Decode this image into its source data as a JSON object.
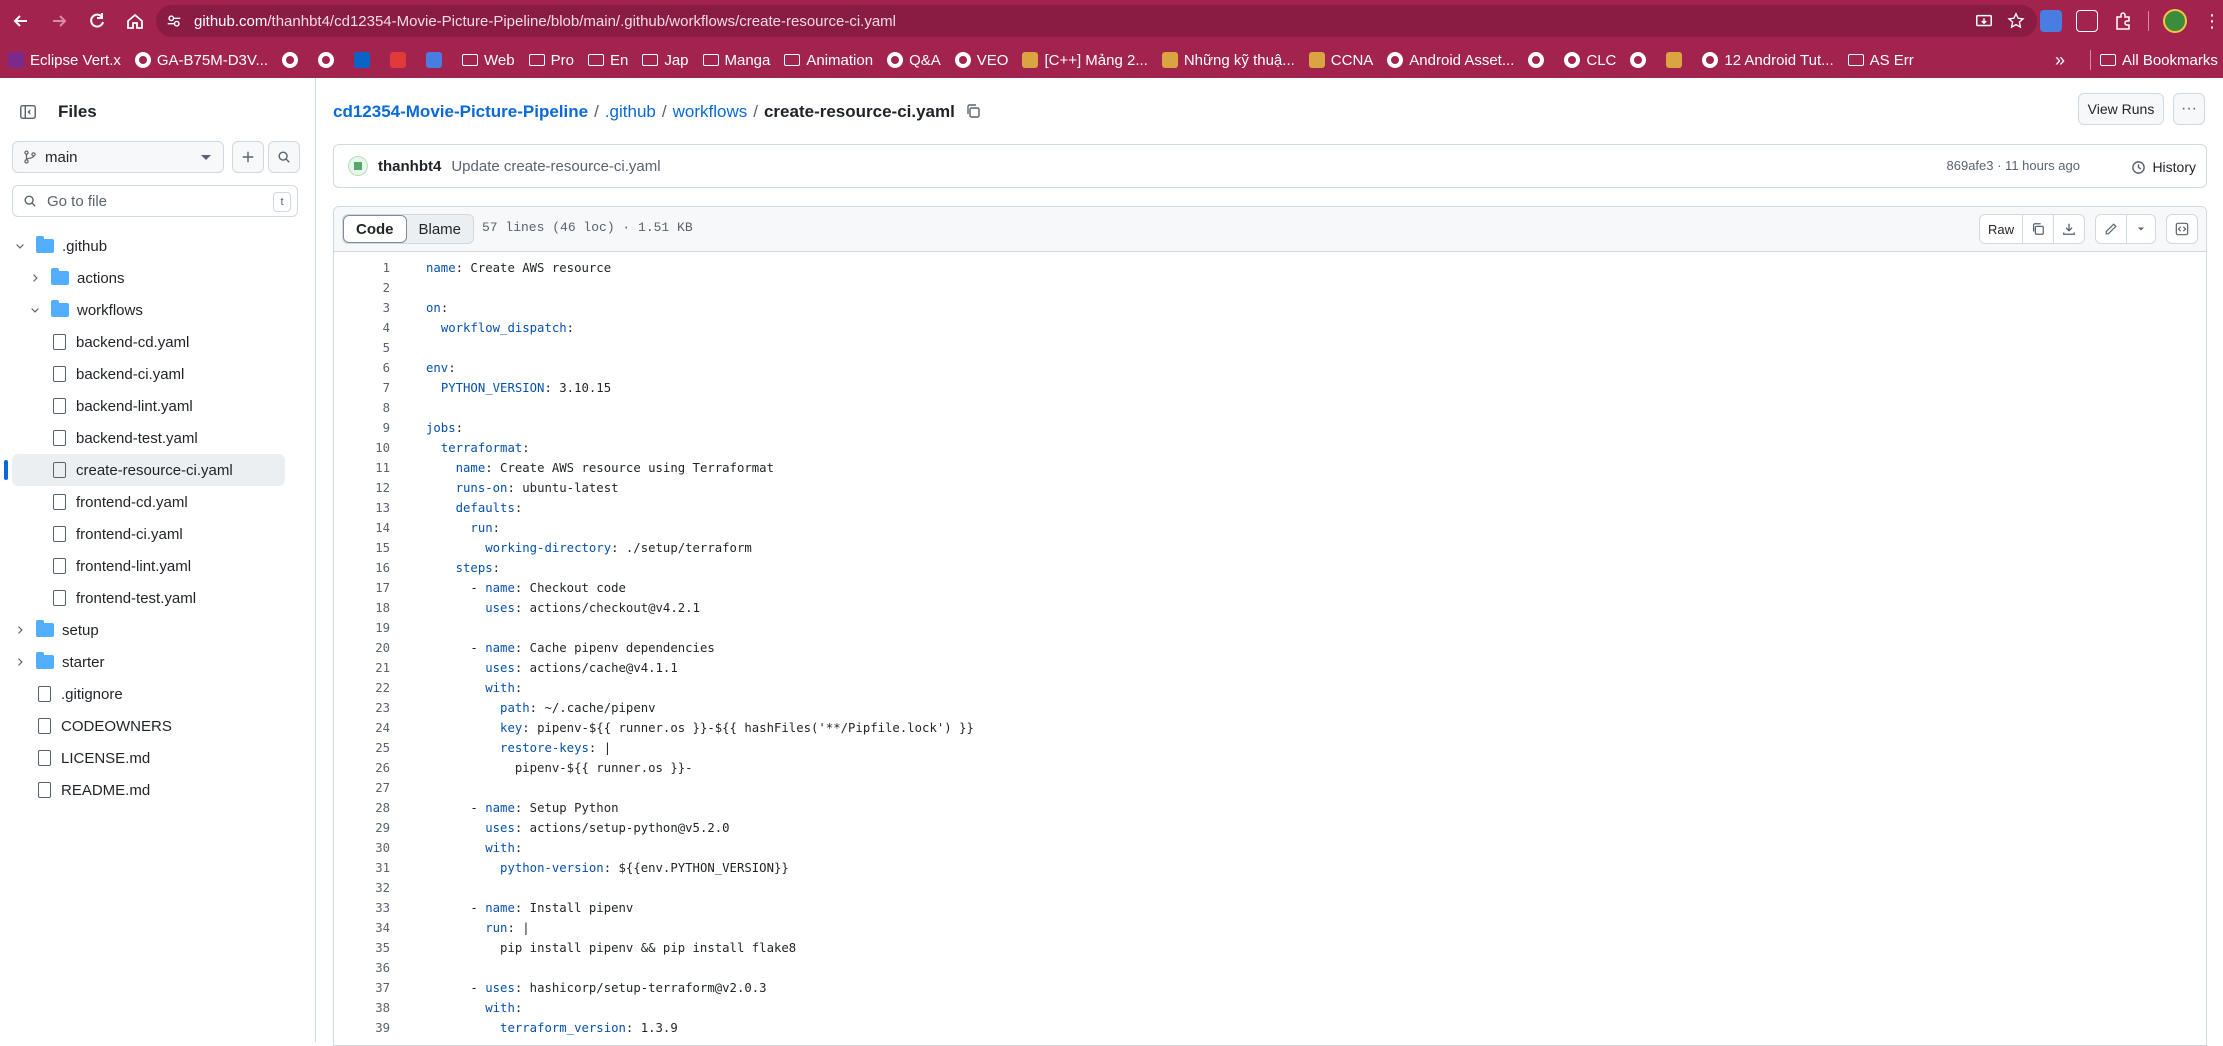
{
  "browser": {
    "url_domain": "github.com",
    "url_path": "/thanhbt4/cd12354-Movie-Picture-Pipeline/blob/main/.github/workflows/create-resource-ci.yaml",
    "bookmarks": [
      {
        "label": "Eclipse Vert.x",
        "icon": "vertx-icon"
      },
      {
        "label": "GA-B75M-D3V...",
        "icon": "globe-icon"
      },
      {
        "label": "",
        "icon": "globe-icon"
      },
      {
        "label": "",
        "icon": "globe-icon"
      },
      {
        "label": "",
        "icon": "outlook-icon"
      },
      {
        "label": "",
        "icon": "red-app-icon"
      },
      {
        "label": "",
        "icon": "translate-icon"
      },
      {
        "label": "Web",
        "icon": "folder-icon"
      },
      {
        "label": "Pro",
        "icon": "folder-icon"
      },
      {
        "label": "En",
        "icon": "folder-icon"
      },
      {
        "label": "Jap",
        "icon": "folder-icon"
      },
      {
        "label": "Manga",
        "icon": "folder-icon"
      },
      {
        "label": "Animation",
        "icon": "folder-icon"
      },
      {
        "label": "Q&A",
        "icon": "globe-icon"
      },
      {
        "label": "VEO",
        "icon": "globe-icon"
      },
      {
        "label": "[C++] Mảng 2...",
        "icon": "site-icon"
      },
      {
        "label": "Những kỹ thuậ...",
        "icon": "site-icon"
      },
      {
        "label": "CCNA",
        "icon": "site-icon"
      },
      {
        "label": "Android Asset...",
        "icon": "globe-icon"
      },
      {
        "label": "",
        "icon": "globe-icon"
      },
      {
        "label": "CLC",
        "icon": "globe-icon"
      },
      {
        "label": "",
        "icon": "globe-icon"
      },
      {
        "label": "",
        "icon": "site-icon"
      },
      {
        "label": "12 Android Tut...",
        "icon": "globe-icon"
      },
      {
        "label": "AS Err",
        "icon": "folder-icon"
      }
    ],
    "more_label": "»",
    "all_bookmarks": "All Bookmarks"
  },
  "sidebar": {
    "title": "Files",
    "branch": "main",
    "goto_placeholder": "Go to file",
    "goto_shortcut": "t",
    "tree": [
      {
        "label": ".github",
        "type": "folder",
        "depth": 0,
        "expanded": true
      },
      {
        "label": "actions",
        "type": "folder",
        "depth": 1,
        "expanded": false
      },
      {
        "label": "workflows",
        "type": "folder",
        "depth": 1,
        "expanded": true
      },
      {
        "label": "backend-cd.yaml",
        "type": "file",
        "depth": 2
      },
      {
        "label": "backend-ci.yaml",
        "type": "file",
        "depth": 2
      },
      {
        "label": "backend-lint.yaml",
        "type": "file",
        "depth": 2
      },
      {
        "label": "backend-test.yaml",
        "type": "file",
        "depth": 2
      },
      {
        "label": "create-resource-ci.yaml",
        "type": "file",
        "depth": 2,
        "active": true
      },
      {
        "label": "frontend-cd.yaml",
        "type": "file",
        "depth": 2
      },
      {
        "label": "frontend-ci.yaml",
        "type": "file",
        "depth": 2
      },
      {
        "label": "frontend-lint.yaml",
        "type": "file",
        "depth": 2
      },
      {
        "label": "frontend-test.yaml",
        "type": "file",
        "depth": 2
      },
      {
        "label": "setup",
        "type": "folder",
        "depth": 0,
        "expanded": false
      },
      {
        "label": "starter",
        "type": "folder",
        "depth": 0,
        "expanded": false
      },
      {
        "label": ".gitignore",
        "type": "file",
        "depth": 0
      },
      {
        "label": "CODEOWNERS",
        "type": "file",
        "depth": 0
      },
      {
        "label": "LICENSE.md",
        "type": "file",
        "depth": 0
      },
      {
        "label": "README.md",
        "type": "file",
        "depth": 0
      }
    ]
  },
  "breadcrumb": {
    "repo": "cd12354-Movie-Picture-Pipeline",
    "dir1": ".github",
    "dir2": "workflows",
    "file": "create-resource-ci.yaml",
    "sep": "/"
  },
  "actions": {
    "view_runs": "View Runs",
    "more": "···"
  },
  "commit": {
    "author": "thanhbt4",
    "message": "Update create-resource-ci.yaml",
    "meta": "869afe3 · 11 hours ago",
    "history": "History"
  },
  "code_header": {
    "tab_code": "Code",
    "tab_blame": "Blame",
    "stats": "57 lines (46 loc) · 1.51 KB",
    "raw": "Raw"
  },
  "code_lines": [
    {
      "n": "1",
      "indent": "",
      "key": "name",
      "rest": ": Create AWS resource"
    },
    {
      "n": "2",
      "indent": "",
      "key": "",
      "rest": ""
    },
    {
      "n": "3",
      "indent": "",
      "key": "on",
      "rest": ":"
    },
    {
      "n": "4",
      "indent": "  ",
      "key": "workflow_dispatch",
      "rest": ":"
    },
    {
      "n": "5",
      "indent": "",
      "key": "",
      "rest": ""
    },
    {
      "n": "6",
      "indent": "",
      "key": "env",
      "rest": ":"
    },
    {
      "n": "7",
      "indent": "  ",
      "key": "PYTHON_VERSION",
      "rest": ": 3.10.15"
    },
    {
      "n": "8",
      "indent": "",
      "key": "",
      "rest": ""
    },
    {
      "n": "9",
      "indent": "",
      "key": "jobs",
      "rest": ":"
    },
    {
      "n": "10",
      "indent": "  ",
      "key": "terraformat",
      "rest": ":"
    },
    {
      "n": "11",
      "indent": "    ",
      "key": "name",
      "rest": ": Create AWS resource using Terraformat"
    },
    {
      "n": "12",
      "indent": "    ",
      "key": "runs-on",
      "rest": ": ubuntu-latest"
    },
    {
      "n": "13",
      "indent": "    ",
      "key": "defaults",
      "rest": ":"
    },
    {
      "n": "14",
      "indent": "      ",
      "key": "run",
      "rest": ":"
    },
    {
      "n": "15",
      "indent": "        ",
      "key": "working-directory",
      "rest": ": ./setup/terraform"
    },
    {
      "n": "16",
      "indent": "    ",
      "key": "steps",
      "rest": ":"
    },
    {
      "n": "17",
      "indent": "      - ",
      "key": "name",
      "rest": ": Checkout code"
    },
    {
      "n": "18",
      "indent": "        ",
      "key": "uses",
      "rest": ": actions/checkout@v4.2.1"
    },
    {
      "n": "19",
      "indent": "",
      "key": "",
      "rest": ""
    },
    {
      "n": "20",
      "indent": "      - ",
      "key": "name",
      "rest": ": Cache pipenv dependencies"
    },
    {
      "n": "21",
      "indent": "        ",
      "key": "uses",
      "rest": ": actions/cache@v4.1.1"
    },
    {
      "n": "22",
      "indent": "        ",
      "key": "with",
      "rest": ":"
    },
    {
      "n": "23",
      "indent": "          ",
      "key": "path",
      "rest": ": ~/.cache/pipenv"
    },
    {
      "n": "24",
      "indent": "          ",
      "key": "key",
      "rest": ": pipenv-${{ runner.os }}-${{ hashFiles('**/Pipfile.lock') }}"
    },
    {
      "n": "25",
      "indent": "          ",
      "key": "restore-keys",
      "rest": ": |"
    },
    {
      "n": "26",
      "indent": "            ",
      "key": "",
      "rest": "pipenv-${{ runner.os }}-"
    },
    {
      "n": "27",
      "indent": "",
      "key": "",
      "rest": ""
    },
    {
      "n": "28",
      "indent": "      - ",
      "key": "name",
      "rest": ": Setup Python"
    },
    {
      "n": "29",
      "indent": "        ",
      "key": "uses",
      "rest": ": actions/setup-python@v5.2.0"
    },
    {
      "n": "30",
      "indent": "        ",
      "key": "with",
      "rest": ":"
    },
    {
      "n": "31",
      "indent": "          ",
      "key": "python-version",
      "rest": ": ${{env.PYTHON_VERSION}}"
    },
    {
      "n": "32",
      "indent": "",
      "key": "",
      "rest": ""
    },
    {
      "n": "33",
      "indent": "      - ",
      "key": "name",
      "rest": ": Install pipenv"
    },
    {
      "n": "34",
      "indent": "        ",
      "key": "run",
      "rest": ": |"
    },
    {
      "n": "35",
      "indent": "          ",
      "key": "",
      "rest": "pip install pipenv && pip install flake8"
    },
    {
      "n": "36",
      "indent": "",
      "key": "",
      "rest": ""
    },
    {
      "n": "37",
      "indent": "      - ",
      "key": "uses",
      "rest": ": hashicorp/setup-terraform@v2.0.3"
    },
    {
      "n": "38",
      "indent": "        ",
      "key": "with",
      "rest": ":"
    },
    {
      "n": "39",
      "indent": "          ",
      "key": "terraform_version",
      "rest": ": 1.3.9"
    }
  ],
  "colors": {
    "accent": "#0969da",
    "chrome": "#a3234f",
    "key": "#0550ae"
  }
}
